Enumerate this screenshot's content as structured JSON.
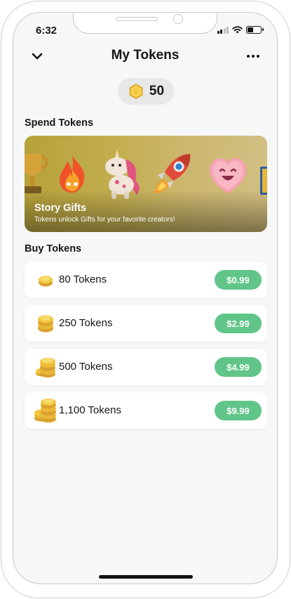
{
  "status_bar": {
    "time": "6:32"
  },
  "header": {
    "title": "My Tokens"
  },
  "balance": {
    "value": "50"
  },
  "spend": {
    "section_label": "Spend Tokens",
    "banner": {
      "title": "Story Gifts",
      "subtitle": "Tokens unlock Gifts for your favorite creators!",
      "gift_icons": [
        "trophy-icon",
        "fire-icon",
        "unicorn-icon",
        "rocket-icon",
        "heart-face-icon",
        "card-icon"
      ]
    }
  },
  "buy": {
    "section_label": "Buy Tokens",
    "packages": [
      {
        "label": "80 Tokens",
        "price": "$0.99"
      },
      {
        "label": "250 Tokens",
        "price": "$2.99"
      },
      {
        "label": "500 Tokens",
        "price": "$4.99"
      },
      {
        "label": "1,100 Tokens",
        "price": "$9.99"
      }
    ]
  },
  "colors": {
    "background": "#f6f7f7",
    "price_button": "#61c589",
    "coin_gold": "#f2c53d",
    "banner_gold": "#c2ad4e"
  }
}
